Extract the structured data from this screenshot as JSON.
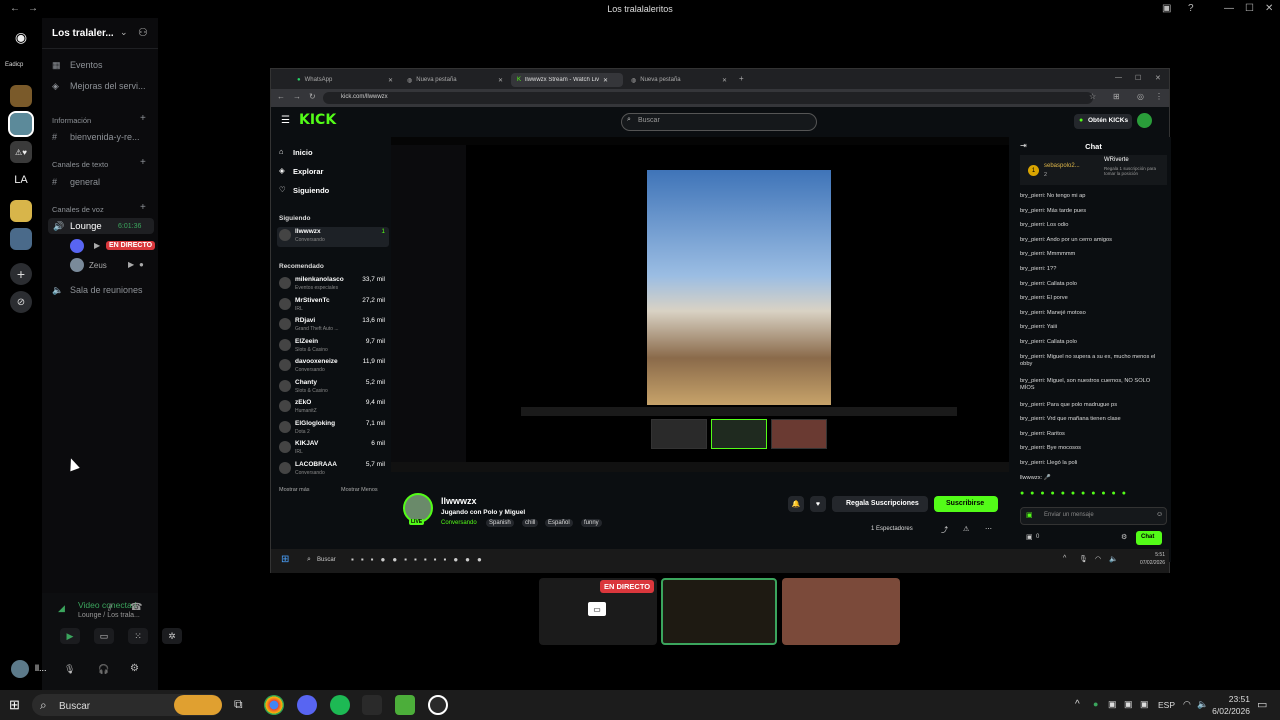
{
  "window": {
    "title": "Los tralalaleritos"
  },
  "server": {
    "name": "Los tralaler...",
    "name_label": "Eadicp"
  },
  "channels": {
    "events": "Eventos",
    "boosts": "Mejoras del servi...",
    "info_cat": "Información",
    "info_ch": "bienvenida-y-re...",
    "text_cat": "Canales de texto",
    "general": "general",
    "voice_cat": "Canales de voz",
    "lounge": "Lounge",
    "lounge_time": "6:01:36",
    "live": "EN DIRECTO",
    "zeus": "Zeus",
    "meeting": "Sala de reuniones"
  },
  "voice_panel": {
    "status": "Video conectad",
    "sub": "Lounge / Los trala...",
    "user": "ll..."
  },
  "browser": {
    "tabs": [
      "WhatsApp",
      "Nueva pestaña",
      "llwwwzx Stream - Watch Live o...",
      "Nueva pestaña"
    ],
    "url": "kick.com/llwwwzx",
    "search_placeholder": "Buscar",
    "kicks": "Obtén KICKs"
  },
  "kick": {
    "nav": [
      "Inicio",
      "Explorar",
      "Siguiendo"
    ],
    "following_title": "Siguiendo",
    "following": {
      "name": "llwwwzx",
      "sub": "Conversando",
      "count": "1"
    },
    "recommended_title": "Recomendado",
    "recommended": [
      {
        "name": "milenkanolasco",
        "sub": "Eventos especiales",
        "viewers": "33,7 mil"
      },
      {
        "name": "MrStivenTc",
        "sub": "IRL",
        "viewers": "27,2 mil"
      },
      {
        "name": "RDjavi",
        "sub": "Grand Theft Auto ...",
        "viewers": "13,6 mil"
      },
      {
        "name": "ElZeein",
        "sub": "Slots & Casino",
        "viewers": "9,7 mil"
      },
      {
        "name": "davooxeneize",
        "sub": "Conversando",
        "viewers": "11,9 mil"
      },
      {
        "name": "Chanty",
        "sub": "Slots & Casino",
        "viewers": "5,2 mil"
      },
      {
        "name": "zEkO",
        "sub": "HumanitZ",
        "viewers": "9,4 mil"
      },
      {
        "name": "ElGlogloking",
        "sub": "Dota 2",
        "viewers": "7,1 mil"
      },
      {
        "name": "KIKJAV",
        "sub": "IRL",
        "viewers": "6 mil"
      },
      {
        "name": "LACOBRAAA",
        "sub": "Conversando",
        "viewers": "5,7 mil"
      }
    ],
    "show_more": "Mostrar más",
    "show_less": "Mostrar Menos",
    "streamer": "llwwwzx",
    "stream_title": "Jugando con Polo y Miguel",
    "live_badge": "LIVE",
    "tags": [
      "Conversando",
      "Spanish",
      "chill",
      "Español",
      "funny"
    ],
    "gift_btn": "Regala Suscripciones",
    "sub_btn": "Suscribirse",
    "viewers": "1 Espectadores"
  },
  "chat": {
    "title": "Chat",
    "top1": "sebaspolo2...",
    "top1_count": "2",
    "top2": "WRiverte",
    "top2_note": "Regala 1 suscripción para tomar la posición",
    "messages": [
      "bry_pierri: No tengo mi ap",
      "bry_pierri: Más tarde pues",
      "bry_pierri: Los odio",
      "bry_pierri: Ando por un cerro amigos",
      "bry_pierri: Mmmmmm",
      "bry_pierri: 1??",
      "bry_pierri: Callata polo",
      "bry_pierri: El porve",
      "bry_pierri: Manejé motoso",
      "bry_pierri: Yaiii",
      "bry_pierri: Callata polo",
      "bry_pierri: Miguel no supera a su ex, mucho menos el obby",
      "bry_pierri: Miguel, son nuestros cuernos, NO SOLO MÍOS",
      "bry_pierri: Para que polo madrugue ps",
      "bry_pierri: Vrd que mañana tienen clase",
      "bry_pierri: Raritos",
      "bry_pierri: Bye mocosos",
      "bry_pierri: Llegó la poli",
      "llwwwzx: 🎤"
    ],
    "input_placeholder": "Enviar un mensaje",
    "kicks_count": "0",
    "send": "Chat"
  },
  "inner_taskbar": {
    "search": "Buscar",
    "time": "5:51",
    "date": "07/02/2026"
  },
  "bottom_tiles": {
    "live": "EN DIRECTO"
  },
  "taskbar": {
    "search": "Buscar",
    "lang": "ESP",
    "time": "23:51",
    "date": "6/02/2026"
  }
}
